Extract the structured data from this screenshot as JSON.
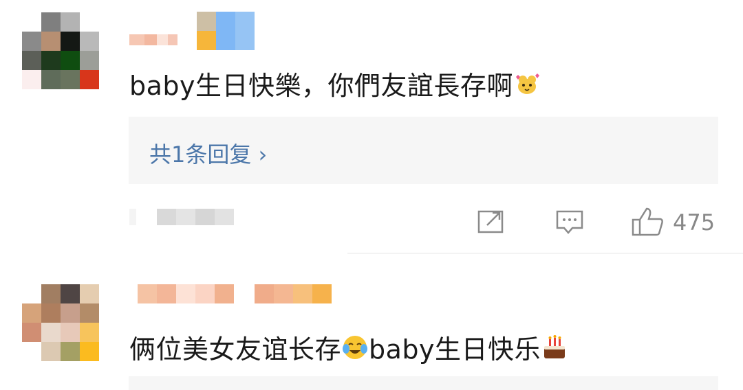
{
  "comments": [
    {
      "text_before": "baby生日快樂，你們友誼長存啊",
      "emoji_after": "hamster-hearts-emoji",
      "reply_link": "共1条回复 ›",
      "like_count": "475"
    },
    {
      "text_before": "俩位美女友谊长存",
      "emoji_mid": "crying-laughing-emoji",
      "text_after": "baby生日快乐",
      "emoji_end": "birthday-cake-emoji"
    }
  ],
  "colors": {
    "link_blue": "#4b76a9",
    "reply_bg": "#f6f6f6",
    "meta_gray": "#888888"
  },
  "icons": [
    "share-icon",
    "comment-icon",
    "like-icon"
  ]
}
